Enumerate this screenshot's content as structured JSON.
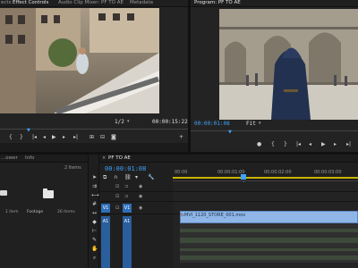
{
  "source_monitor": {
    "tabs": [
      "ects",
      "Effect Controls",
      "Audio Clip Mixer: PF TO AE",
      "Metadata"
    ],
    "zoom": "1/2",
    "timecode": "00:00:15:22"
  },
  "program_monitor": {
    "tab": "Program: PF TO AE",
    "timecode": "00:00:01:08",
    "fit": "Fit"
  },
  "project_panel": {
    "tabs": [
      "...ower",
      "Info"
    ],
    "count": "2 Items",
    "items": [
      {
        "name": "",
        "sub": "1 item"
      },
      {
        "name": "Footage",
        "sub": "26 items"
      }
    ]
  },
  "timeline": {
    "sequence_tab": "PF TO AE",
    "timecode": "00:00:01:08",
    "ruler": [
      "00:00",
      "00:00:01:00",
      "00:00:02:00",
      "00:00:03:00"
    ],
    "tracks": [
      {
        "name": "V3",
        "labels": [
          "V1"
        ]
      },
      {
        "name": "V2",
        "labels": []
      },
      {
        "name": "V1",
        "labels": [
          "V1"
        ]
      }
    ],
    "audio_track_labels": [
      "A1",
      "A1",
      "A1"
    ],
    "clip_name": "MVI_1120_STORE_001.mov"
  }
}
